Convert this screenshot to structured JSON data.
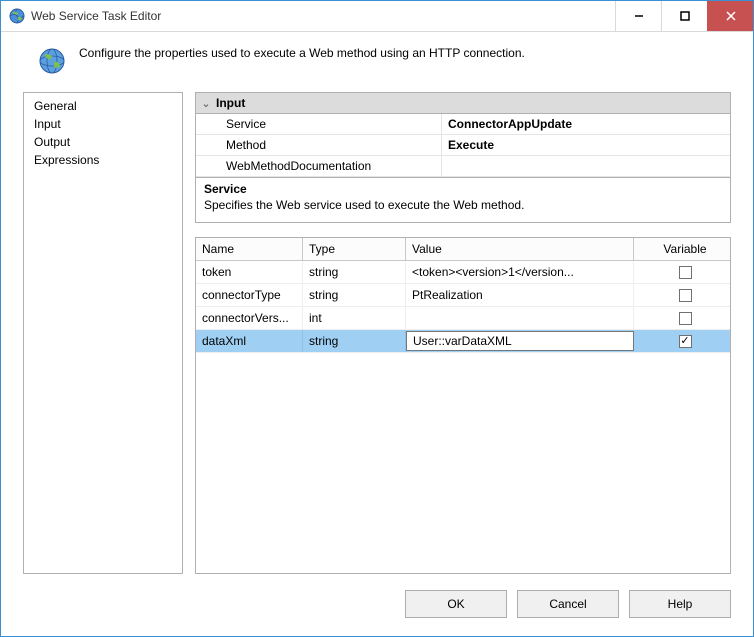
{
  "window": {
    "title": "Web Service Task Editor",
    "description": "Configure the properties used to execute a Web method using an HTTP connection."
  },
  "sidebar": {
    "items": [
      {
        "label": "General"
      },
      {
        "label": "Input"
      },
      {
        "label": "Output"
      },
      {
        "label": "Expressions"
      }
    ]
  },
  "propgrid": {
    "category": "Input",
    "rows": [
      {
        "name": "Service",
        "value": "ConnectorAppUpdate",
        "bold": true
      },
      {
        "name": "Method",
        "value": "Execute",
        "bold": true
      },
      {
        "name": "WebMethodDocumentation",
        "value": "",
        "bold": false
      }
    ]
  },
  "propdesc": {
    "title": "Service",
    "text": "Specifies the Web service used to execute the Web method."
  },
  "params": {
    "headers": {
      "name": "Name",
      "type": "Type",
      "value": "Value",
      "variable": "Variable"
    },
    "rows": [
      {
        "name": "token",
        "type": "string",
        "value": "<token><version>1</version...",
        "variable": false
      },
      {
        "name": "connectorType",
        "type": "string",
        "value": "PtRealization",
        "variable": false
      },
      {
        "name": "connectorVers...",
        "type": "int",
        "value": "",
        "variable": false
      },
      {
        "name": "dataXml",
        "type": "string",
        "value": "User::varDataXML",
        "variable": true,
        "selected": true
      }
    ]
  },
  "footer": {
    "ok": "OK",
    "cancel": "Cancel",
    "help": "Help"
  }
}
